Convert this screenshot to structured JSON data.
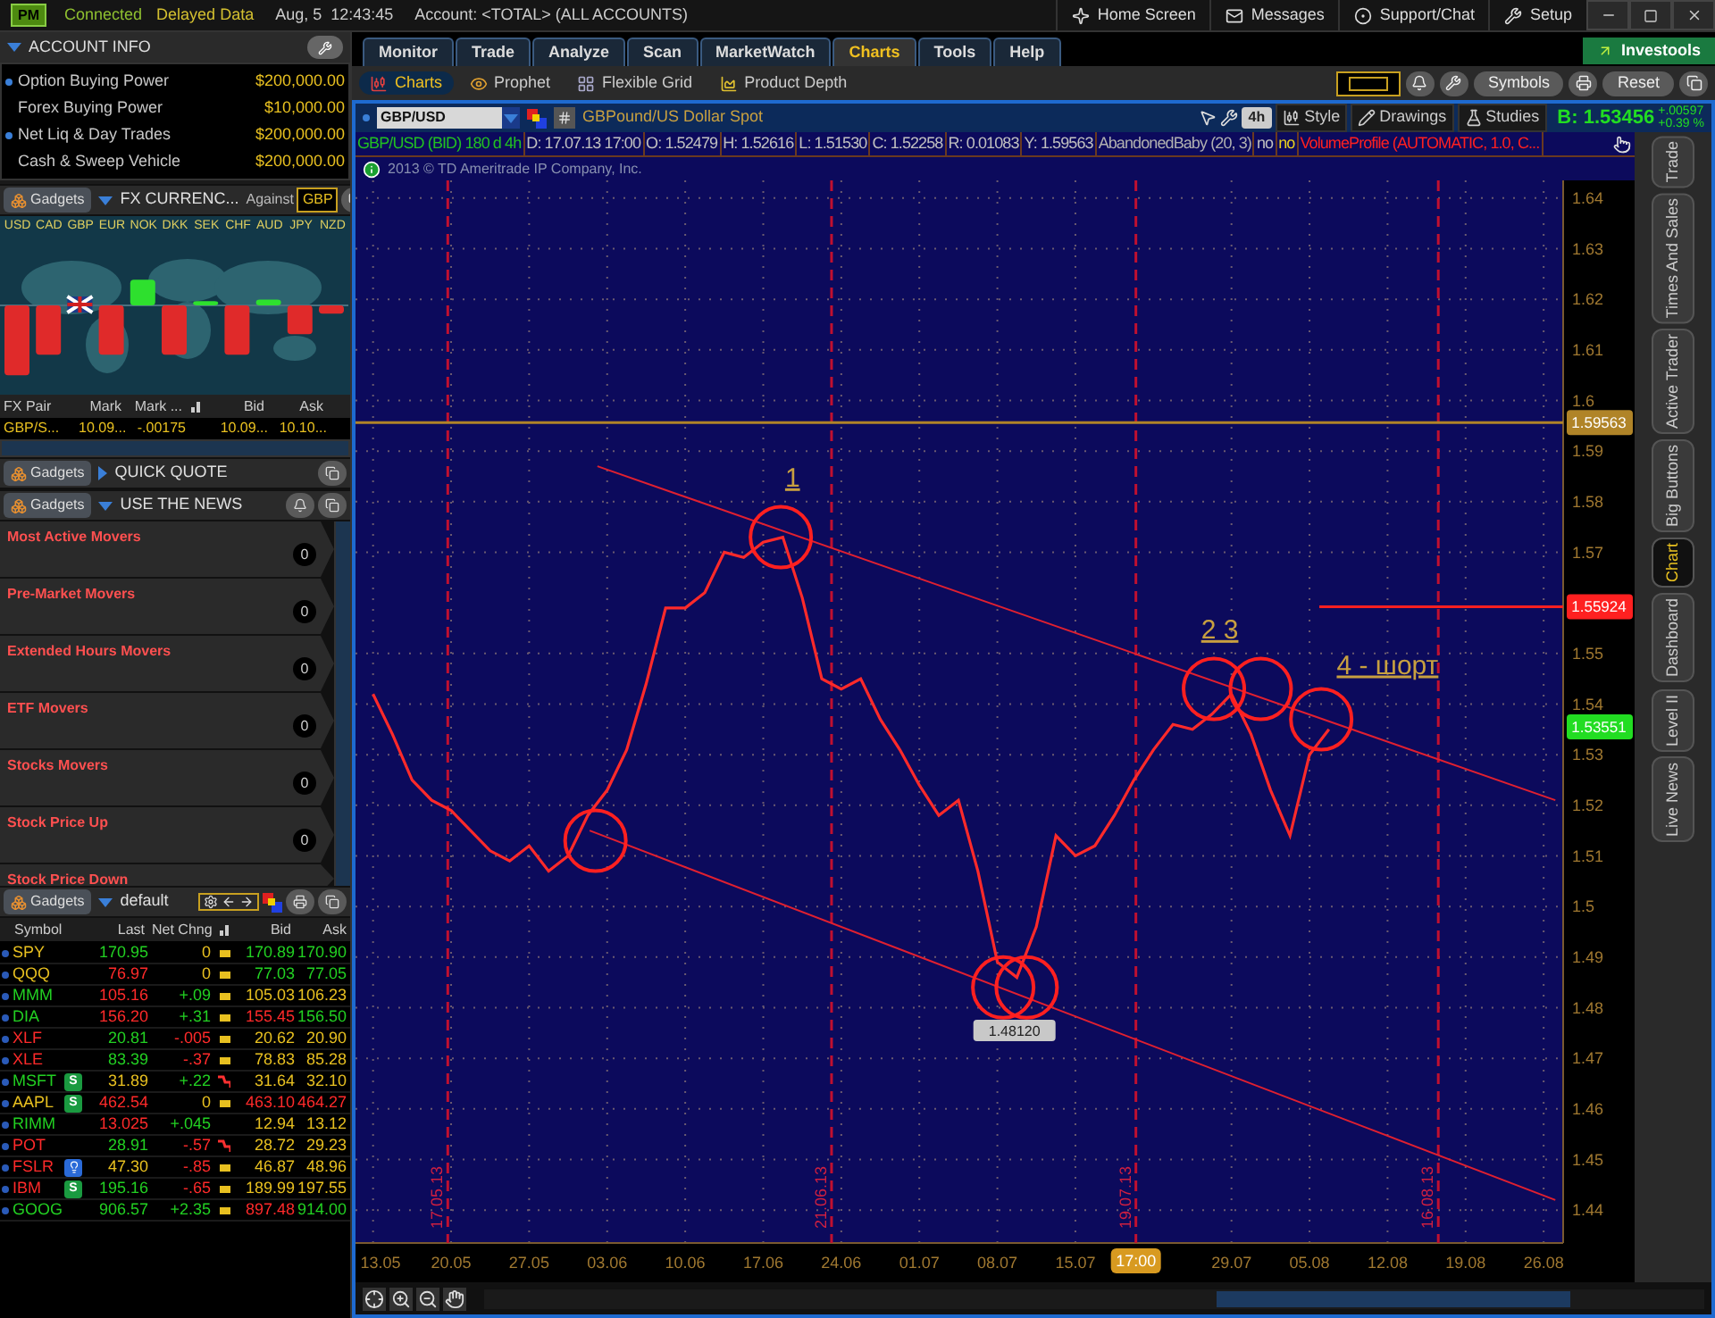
{
  "top_bar": {
    "logo": "PM",
    "status": "Connected",
    "data_mode": "Delayed Data",
    "datetime": "Aug, 5  12:43:45",
    "account": "Account: <TOTAL> (ALL ACCOUNTS)",
    "links": [
      {
        "label": "Home Screen",
        "kind": "home"
      },
      {
        "label": "Messages",
        "kind": "messages"
      },
      {
        "label": "Support/Chat",
        "kind": "support"
      },
      {
        "label": "Setup",
        "kind": "setup"
      }
    ]
  },
  "account_info": {
    "title": "ACCOUNT INFO",
    "rows": [
      {
        "label": "Option Buying Power",
        "value": "$200,000.00",
        "bullet": true
      },
      {
        "label": "Forex Buying Power",
        "value": "$10,000.00",
        "bullet": false
      },
      {
        "label": "Net Liq & Day Trades",
        "value": "$200,000.00",
        "bullet": true
      },
      {
        "label": "Cash & Sweep Vehicle",
        "value": "$200,000.00",
        "bullet": false
      }
    ]
  },
  "fx_gadget": {
    "gadgets_label": "Gadgets",
    "title": "FX CURRENC...",
    "expanded": true,
    "against_label": "Against",
    "against_value": "GBP",
    "currencies": [
      "USD",
      "CAD",
      "GBP",
      "EUR",
      "NOK",
      "DKK",
      "SEK",
      "CHF",
      "AUD",
      "JPY",
      "NZD"
    ],
    "columns": [
      {
        "kind": "text",
        "label": "FX Pair"
      },
      {
        "kind": "text",
        "label": "Mark"
      },
      {
        "kind": "text",
        "label": "Mark ..."
      },
      {
        "kind": "icon"
      },
      {
        "kind": "text",
        "label": "Bid"
      },
      {
        "kind": "text",
        "label": "Ask"
      }
    ],
    "rows": [
      {
        "pair": "GBP/S...",
        "mark": "10.09...",
        "mark_change": "-.00175",
        "bid": "10.09...",
        "ask": "10.10..."
      }
    ]
  },
  "quick_quote": {
    "gadgets_label": "Gadgets",
    "title": "QUICK QUOTE",
    "expanded": false
  },
  "news": {
    "gadgets_label": "Gadgets",
    "title": "USE THE NEWS",
    "expanded": true,
    "items": [
      {
        "label": "Most Active Movers",
        "count": "0"
      },
      {
        "label": "Pre-Market Movers",
        "count": "0"
      },
      {
        "label": "Extended Hours Movers",
        "count": "0"
      },
      {
        "label": "ETF Movers",
        "count": "0"
      },
      {
        "label": "Stocks Movers",
        "count": "0"
      },
      {
        "label": "Stock Price Up",
        "count": "0"
      },
      {
        "label": "Stock Price Down"
      }
    ]
  },
  "watchlist": {
    "gadgets_label": "Gadgets",
    "title": "default",
    "expanded": true,
    "columns": [
      {
        "kind": "text",
        "label": "Symbol"
      },
      {
        "kind": "text",
        "label": "Last"
      },
      {
        "kind": "text",
        "label": "Net Chng"
      },
      {
        "kind": "icon"
      },
      {
        "kind": "text",
        "label": "Bid"
      },
      {
        "kind": "text",
        "label": "Ask"
      }
    ],
    "rows": [
      {
        "symbol": {
          "text": "SPY",
          "color": "#e8c020"
        },
        "last": {
          "text": "170.95",
          "color": "#22d022"
        },
        "net_chng": {
          "text": "0",
          "color": "#e8c020"
        },
        "kind": "flat",
        "bid": {
          "text": "170.89",
          "color": "#22d022"
        },
        "ask": {
          "text": "170.90",
          "color": "#22d022"
        }
      },
      {
        "symbol": {
          "text": "QQQ",
          "color": "#e8c020"
        },
        "last": {
          "text": "76.97",
          "color": "#ff2a2a"
        },
        "net_chng": {
          "text": "0",
          "color": "#e8c020"
        },
        "kind": "flat",
        "bid": {
          "text": "77.03",
          "color": "#22d022"
        },
        "ask": {
          "text": "77.05",
          "color": "#22d022"
        }
      },
      {
        "symbol": {
          "text": "MMM",
          "color": "#22d022"
        },
        "last": {
          "text": "105.16",
          "color": "#ff2a2a"
        },
        "net_chng": {
          "text": "+.09",
          "color": "#22d022"
        },
        "kind": "flat",
        "bid": {
          "text": "105.03",
          "color": "#e8c020"
        },
        "ask": {
          "text": "106.23",
          "color": "#e8c020"
        }
      },
      {
        "symbol": {
          "text": "DIA",
          "color": "#22d022"
        },
        "last": {
          "text": "156.20",
          "color": "#ff2a2a"
        },
        "net_chng": {
          "text": "+.31",
          "color": "#22d022"
        },
        "kind": "flat",
        "bid": {
          "text": "155.45",
          "color": "#ff2a2a"
        },
        "ask": {
          "text": "156.50",
          "color": "#22d022"
        }
      },
      {
        "symbol": {
          "text": "XLF",
          "color": "#ff2a2a"
        },
        "last": {
          "text": "20.81",
          "color": "#22d022"
        },
        "net_chng": {
          "text": "-.005",
          "color": "#ff2a2a"
        },
        "kind": "flat",
        "bid": {
          "text": "20.62",
          "color": "#e8c020"
        },
        "ask": {
          "text": "20.90",
          "color": "#e8c020"
        }
      },
      {
        "symbol": {
          "text": "XLE",
          "color": "#ff2a2a"
        },
        "last": {
          "text": "83.39",
          "color": "#22d022"
        },
        "net_chng": {
          "text": "-.37",
          "color": "#ff2a2a"
        },
        "kind": "flat",
        "bid": {
          "text": "78.83",
          "color": "#e8c020"
        },
        "ask": {
          "text": "85.28",
          "color": "#e8c020"
        }
      },
      {
        "symbol": {
          "text": "MSFT",
          "color": "#22d022"
        },
        "badge": {
          "kind": "letter",
          "text": "S"
        },
        "last": {
          "text": "31.89",
          "color": "#e8c020"
        },
        "net_chng": {
          "text": "+.22",
          "color": "#22d022"
        },
        "kind": "down",
        "bid": {
          "text": "31.64",
          "color": "#e8c020"
        },
        "ask": {
          "text": "32.10",
          "color": "#e8c020"
        }
      },
      {
        "symbol": {
          "text": "AAPL",
          "color": "#e8c020"
        },
        "badge": {
          "kind": "letter",
          "text": "S"
        },
        "last": {
          "text": "462.54",
          "color": "#ff2a2a"
        },
        "net_chng": {
          "text": "0",
          "color": "#e8c020"
        },
        "kind": "flat",
        "bid": {
          "text": "463.10",
          "color": "#ff2a2a"
        },
        "ask": {
          "text": "464.27",
          "color": "#ff2a2a"
        }
      },
      {
        "symbol": {
          "text": "RIMM",
          "color": "#22d022"
        },
        "last": {
          "text": "13.025",
          "color": "#ff2a2a"
        },
        "net_chng": {
          "text": "+.045",
          "color": "#22d022"
        },
        "kind": "none",
        "bid": {
          "text": "12.94",
          "color": "#e8c020"
        },
        "ask": {
          "text": "13.12",
          "color": "#e8c020"
        }
      },
      {
        "symbol": {
          "text": "POT",
          "color": "#ff2a2a"
        },
        "last": {
          "text": "28.91",
          "color": "#22d022"
        },
        "net_chng": {
          "text": "-.57",
          "color": "#ff2a2a"
        },
        "kind": "down",
        "bid": {
          "text": "28.72",
          "color": "#e8c020"
        },
        "ask": {
          "text": "29.23",
          "color": "#e8c020"
        }
      },
      {
        "symbol": {
          "text": "FSLR",
          "color": "#ff2a2a"
        },
        "badge": {
          "kind": "idea"
        },
        "last": {
          "text": "47.30",
          "color": "#e8c020"
        },
        "net_chng": {
          "text": "-.85",
          "color": "#ff2a2a"
        },
        "kind": "flat",
        "bid": {
          "text": "46.87",
          "color": "#e8c020"
        },
        "ask": {
          "text": "48.96",
          "color": "#e8c020"
        }
      },
      {
        "symbol": {
          "text": "IBM",
          "color": "#ff2a2a"
        },
        "badge": {
          "kind": "letter",
          "text": "S"
        },
        "last": {
          "text": "195.16",
          "color": "#22d022"
        },
        "net_chng": {
          "text": "-.65",
          "color": "#ff2a2a"
        },
        "kind": "flat",
        "bid": {
          "text": "189.99",
          "color": "#e8c020"
        },
        "ask": {
          "text": "197.55",
          "color": "#e8c020"
        }
      },
      {
        "symbol": {
          "text": "GOOG",
          "color": "#22d022"
        },
        "last": {
          "text": "906.57",
          "color": "#22d022"
        },
        "net_chng": {
          "text": "+2.35",
          "color": "#22d022"
        },
        "kind": "flat",
        "bid": {
          "text": "897.48",
          "color": "#ff2a2a"
        },
        "ask": {
          "text": "914.00",
          "color": "#22d022"
        }
      }
    ]
  },
  "main_tabs": [
    {
      "label": "Monitor",
      "selected": false
    },
    {
      "label": "Trade",
      "selected": false
    },
    {
      "label": "Analyze",
      "selected": false
    },
    {
      "label": "Scan",
      "selected": false
    },
    {
      "label": "MarketWatch",
      "selected": false
    },
    {
      "label": "Charts",
      "selected": true
    },
    {
      "label": "Tools",
      "selected": false
    },
    {
      "label": "Help",
      "selected": false
    }
  ],
  "investools": "Investools",
  "sub_tabs": [
    {
      "label": "Charts",
      "kind": "charts",
      "selected": true
    },
    {
      "label": "Prophet",
      "kind": "prophet",
      "selected": false
    },
    {
      "label": "Flexible Grid",
      "kind": "grid",
      "selected": false
    },
    {
      "label": "Product Depth",
      "kind": "depth",
      "selected": false
    }
  ],
  "toolbar": [
    {
      "kind": "swatch"
    },
    {
      "kind": "bell"
    },
    {
      "kind": "wrench"
    },
    {
      "kind": "text",
      "label": "Symbols"
    },
    {
      "kind": "print"
    },
    {
      "kind": "text",
      "label": "Reset"
    },
    {
      "kind": "popout"
    }
  ],
  "chart": {
    "description": "GBPound/US Dollar Spot",
    "aggregation": "4h",
    "tools": [
      {
        "label": "Style",
        "kind": "style"
      },
      {
        "label": "Drawings",
        "kind": "drawings"
      },
      {
        "label": "Studies",
        "kind": "studies"
      }
    ],
    "bid": "B: 1.53456",
    "change": "+.00597",
    "change_pct": "+0.39 %",
    "info": [
      {
        "text": "GBP/USD (BID) 180 d 4h",
        "kind": "title"
      },
      {
        "text": "D: 17.07.13 17:00",
        "kind": "value"
      },
      {
        "text": "O: 1.52479",
        "kind": "value"
      },
      {
        "text": "H: 1.52616",
        "kind": "value"
      },
      {
        "text": "L: 1.51530",
        "kind": "value"
      },
      {
        "text": "C: 1.52258",
        "kind": "value"
      },
      {
        "text": "R: 0.01083",
        "kind": "value"
      },
      {
        "text": "Y: 1.59563",
        "kind": "value"
      },
      {
        "text": "AbandonedBaby (20, 3)",
        "kind": "study"
      },
      {
        "text": "no",
        "kind": "value"
      },
      {
        "text": "no",
        "kind": "signal"
      },
      {
        "text": "VolumeProfile (AUTOMATIC, 1.0, C...",
        "kind": "alert"
      }
    ],
    "copyright": "2013 © TD Ameritrade IP Company, Inc.",
    "side_tabs": [
      {
        "label": "Trade",
        "selected": false
      },
      {
        "label": "Times And Sales",
        "selected": false
      },
      {
        "label": "Active Trader",
        "selected": false
      },
      {
        "label": "Big Buttons",
        "selected": false
      },
      {
        "label": "Chart",
        "selected": true
      },
      {
        "label": "Dashboard",
        "selected": false
      },
      {
        "label": "Level II",
        "selected": false
      },
      {
        "label": "Live News",
        "selected": false
      }
    ],
    "chart_data": {
      "type": "line",
      "categories": [
        "13.05",
        null,
        null,
        null,
        "20.05",
        null,
        null,
        null,
        "27.05",
        null,
        null,
        null,
        "03.06",
        null,
        null,
        null,
        "10.06",
        null,
        null,
        null,
        "17.06",
        null,
        null,
        null,
        "24.06",
        null,
        null,
        null,
        "01.07",
        null,
        null,
        null,
        "08.07",
        null,
        null,
        null,
        "15.07",
        null,
        null,
        null,
        null,
        null,
        null,
        null,
        "29.07",
        null,
        null,
        null,
        "05.08",
        null,
        null,
        null,
        "12.08",
        null,
        null,
        null,
        "19.08",
        null,
        null,
        null,
        "26.08"
      ],
      "series": [
        {
          "name": "GBP/USD",
          "color": "#ff2a2a",
          "values": [
            1.542,
            1.534,
            1.525,
            1.521,
            1.519,
            1.515,
            1.511,
            1.509,
            1.512,
            1.507,
            1.51,
            1.518,
            1.523,
            1.531,
            1.544,
            1.559,
            1.559,
            1.562,
            1.57,
            1.569,
            1.572,
            1.573,
            1.561,
            1.545,
            1.543,
            1.545,
            1.537,
            1.531,
            1.524,
            1.518,
            1.521,
            1.507,
            1.489,
            1.486,
            1.496,
            1.514,
            1.51,
            1.512,
            1.518,
            1.525,
            1.531,
            1.536,
            1.535,
            1.538,
            1.542,
            1.534,
            1.523,
            1.514,
            1.53,
            1.535,
            null,
            null,
            null,
            null,
            null,
            null,
            null,
            null,
            null,
            null,
            null
          ]
        }
      ],
      "ylim": [
        1.4335,
        1.6435
      ],
      "grid": true,
      "yticks": [
        1.44,
        1.45,
        1.46,
        1.47,
        1.48,
        1.49,
        1.5,
        1.51,
        1.52,
        1.53,
        1.54,
        1.55,
        1.57,
        1.58,
        1.59,
        1.6,
        1.61,
        1.62,
        1.63,
        1.64
      ],
      "ref_lines": [
        {
          "axis": "y",
          "value": 1.59563,
          "label": "1.59563",
          "color": "#b08428"
        },
        {
          "axis": "y",
          "value": 1.55924,
          "label": "1.55924",
          "color": "#ff2020"
        }
      ],
      "annotations": [
        "1",
        "2 3",
        "4 - шорт",
        "17.05.13",
        "21.06.13",
        "19.07.13",
        "16.08.13",
        "1.48120",
        "17:00",
        "1.53551"
      ]
    }
  }
}
